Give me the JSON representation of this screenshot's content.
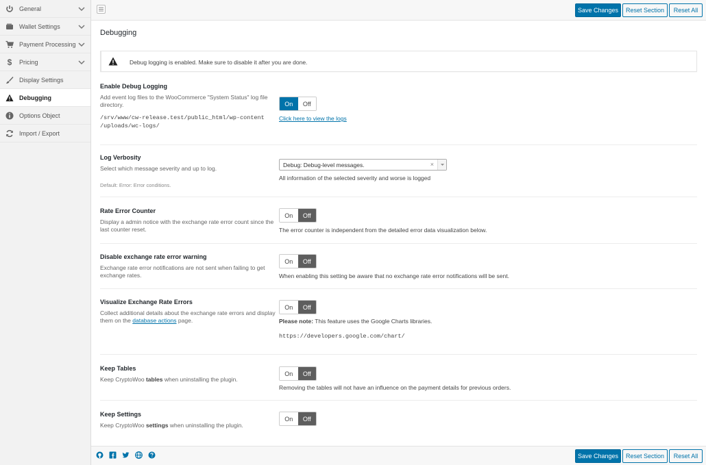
{
  "sidebar": {
    "items": [
      {
        "label": "General",
        "icon": "power-icon",
        "chevron": true
      },
      {
        "label": "Wallet Settings",
        "icon": "wallet-icon",
        "chevron": true
      },
      {
        "label": "Payment Processing",
        "icon": "cart-icon",
        "chevron": true
      },
      {
        "label": "Pricing",
        "icon": "dollar-icon",
        "chevron": true
      },
      {
        "label": "Display Settings",
        "icon": "brush-icon",
        "chevron": false
      },
      {
        "label": "Debugging",
        "icon": "warning-icon",
        "chevron": false,
        "active": true
      },
      {
        "label": "Options Object",
        "icon": "info-icon",
        "chevron": false
      },
      {
        "label": "Import / Export",
        "icon": "refresh-icon",
        "chevron": false
      }
    ]
  },
  "toolbar": {
    "save_label": "Save Changes",
    "reset_section_label": "Reset Section",
    "reset_all_label": "Reset All"
  },
  "section": {
    "title": "Debugging",
    "notice": "Debug logging is enabled. Make sure to disable it after you are done."
  },
  "toggle_labels": {
    "on": "On",
    "off": "Off"
  },
  "settings": {
    "debug_logging": {
      "title": "Enable Debug Logging",
      "desc": "Add event log files to the WooCommerce \"System Status\" log file directory.",
      "path_line1": "/srv/www/cw-release.test/public_html/wp-content",
      "path_line2": "/uploads/wc-logs/",
      "value": "On",
      "link": "Click here to view the logs"
    },
    "log_verbosity": {
      "title": "Log Verbosity",
      "desc": "Select which message severity and up to log.",
      "default": "Default: Error: Error conditions.",
      "selected": "Debug: Debug-level messages.",
      "clear": "×",
      "help": "All information of the selected severity and worse is logged"
    },
    "rate_error_counter": {
      "title": "Rate Error Counter",
      "desc": "Display a admin notice with the exchange rate error count since the last counter reset.",
      "value": "Off",
      "help": "The error counter is independent from the detailed error data visualization below."
    },
    "disable_rate_warning": {
      "title": "Disable exchange rate error warning",
      "desc": "Exchange rate error notifications are not sent when failing to get exchange rates.",
      "value": "Off",
      "help": "When enabling this setting be aware that no exchange rate error notifications will be sent."
    },
    "visualize_errors": {
      "title": "Visualize Exchange Rate Errors",
      "desc_before": "Collect additional details about the exchange rate errors and display them on the ",
      "desc_link": "database actions",
      "desc_after": " page.",
      "value": "Off",
      "note_label": "Please note:",
      "note_text": " This feature uses the Google Charts libraries.",
      "url": "https://developers.google.com/chart/"
    },
    "keep_tables": {
      "title": "Keep Tables",
      "desc_before": "Keep CryptoWoo ",
      "desc_bold": "tables",
      "desc_after": " when uninstalling the plugin.",
      "value": "Off",
      "help": "Removing the tables will not have an influence on the payment details for previous orders."
    },
    "keep_settings": {
      "title": "Keep Settings",
      "desc_before": "Keep CryptoWoo ",
      "desc_bold": "settings",
      "desc_after": " when uninstalling the plugin.",
      "value": "Off"
    }
  },
  "footer": {
    "icons": [
      "github-icon",
      "facebook-icon",
      "twitter-icon",
      "globe-icon",
      "help-icon"
    ]
  },
  "colors": {
    "primary": "#0073aa",
    "toggle_off_selected": "#5e5e5e",
    "sidebar_bg": "#f2f2f2"
  }
}
